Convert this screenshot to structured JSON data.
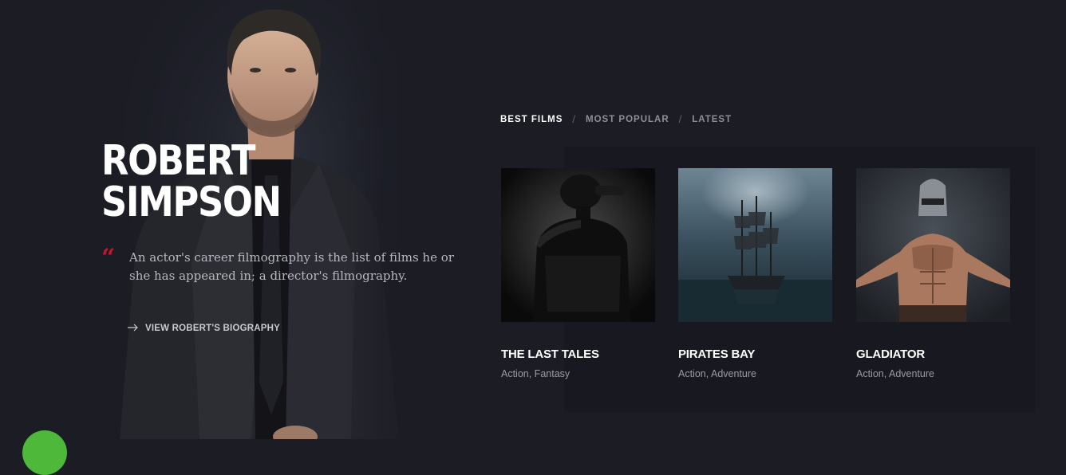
{
  "hero": {
    "name_line1": "ROBERT",
    "name_line2": "SIMPSON",
    "quote_mark": "“",
    "quote": "An actor's career filmography is the list of films he or she has appeared in; a director's filmography.",
    "bio_link_icon": "arrow-right-icon",
    "bio_link_label": "VIEW ROBERT'S BIOGRAPHY"
  },
  "tabs": [
    {
      "label": "BEST FILMS",
      "active": true
    },
    {
      "label": "MOST POPULAR",
      "active": false
    },
    {
      "label": "LATEST",
      "active": false
    }
  ],
  "tab_separator": "/",
  "films": [
    {
      "title": "THE LAST TALES",
      "genres": "Action, Fantasy"
    },
    {
      "title": "PIRATES BAY",
      "genres": "Action, Adventure"
    },
    {
      "title": "GLADIATOR",
      "genres": "Action, Adventure"
    }
  ],
  "colors": {
    "background": "#1b1c24",
    "accent_red": "#c3162a",
    "chat_green": "#4db83a"
  }
}
